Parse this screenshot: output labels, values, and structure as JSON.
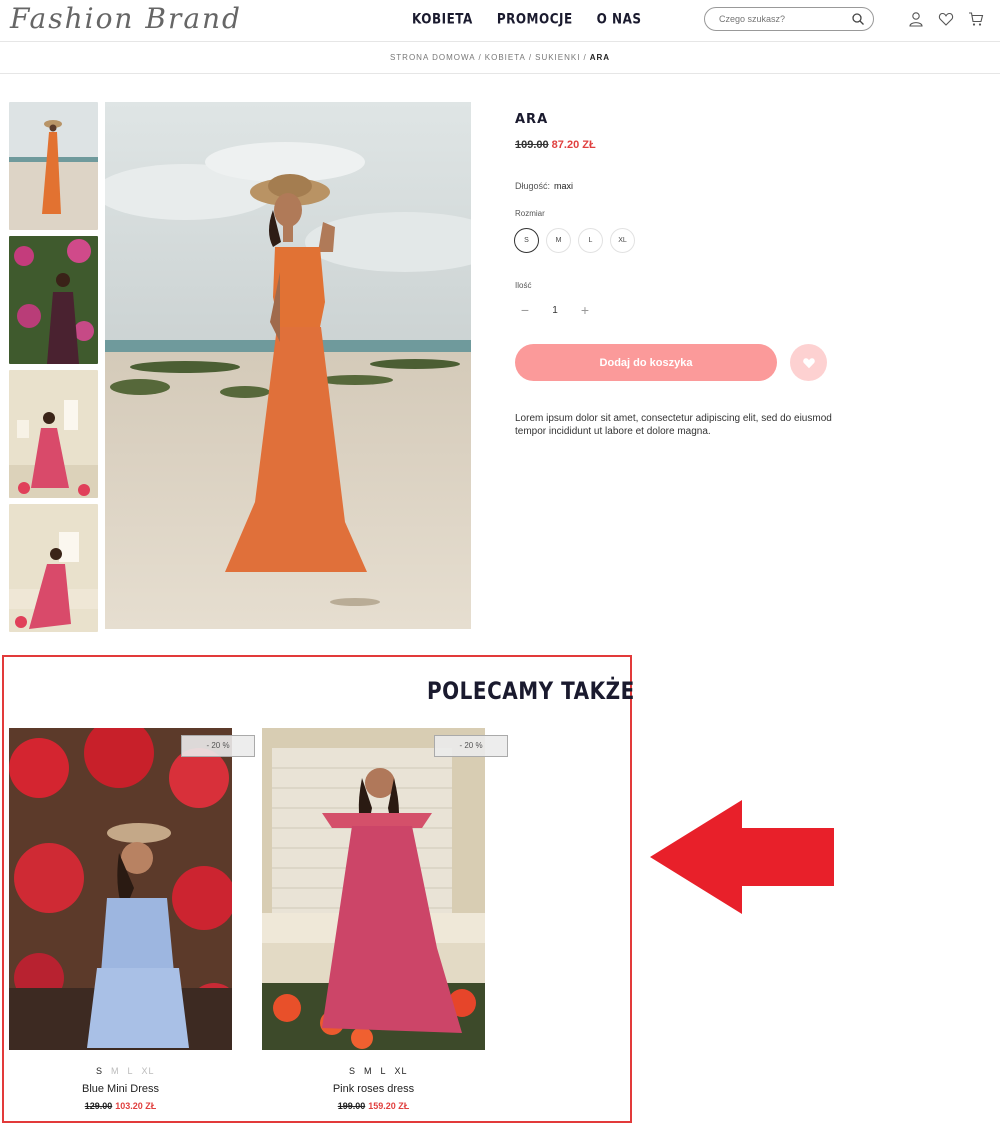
{
  "header": {
    "logo": "Fashion Brand",
    "nav": [
      "KOBIETA",
      "PROMOCJE",
      "O NAS"
    ],
    "search_placeholder": "Czego szukasz?"
  },
  "breadcrumb": [
    "STRONA DOMOWA",
    "KOBIETA",
    "SUKIENKI",
    "ARA"
  ],
  "product": {
    "name": "ARA",
    "old_price": "109.00",
    "new_price": "87.20 ZŁ",
    "length_label": "Długość:",
    "length_value": "maxi",
    "size_label": "Rozmiar",
    "sizes": [
      "S",
      "M",
      "L",
      "XL"
    ],
    "selected_size": "S",
    "qty_label": "Ilość",
    "qty": "1",
    "qty_minus": "−",
    "qty_plus": "+",
    "add_to_cart": "Dodaj do koszyka",
    "description": "Lorem ipsum dolor sit amet, consectetur adipiscing elit, sed do eiusmod tempor incididunt ut labore et dolore magna."
  },
  "recommended": {
    "title": "POLECAMY TAKŻE",
    "items": [
      {
        "badge": "- 20 %",
        "sizes": [
          "S",
          "M",
          "L",
          "XL"
        ],
        "name": "Blue Mini Dress",
        "old_price": "129.00",
        "new_price": "103.20 ZŁ"
      },
      {
        "badge": "- 20 %",
        "sizes": [
          "S",
          "M",
          "L",
          "XL"
        ],
        "name": "Pink roses dress",
        "old_price": "199.00",
        "new_price": "159.20 ZŁ"
      }
    ]
  },
  "colors": {
    "accent": "#fb9a9a",
    "sale_red": "#e0403f",
    "annotation_red": "#e8202a"
  }
}
